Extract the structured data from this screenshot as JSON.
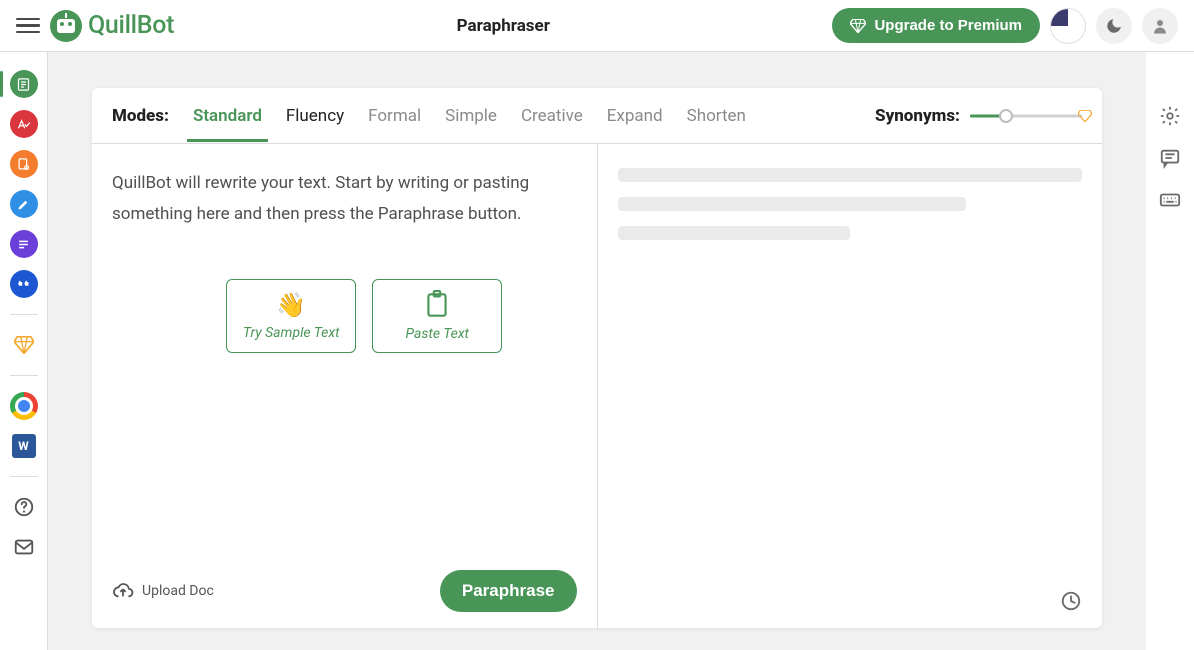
{
  "header": {
    "brand": "QuillBot",
    "title": "Paraphraser",
    "upgrade_label": "Upgrade to Premium"
  },
  "sidebar": {
    "items": [
      {
        "name": "paraphraser",
        "color": "#499557",
        "glyph": "doc"
      },
      {
        "name": "grammar-checker",
        "color": "#d9363e",
        "glyph": "check"
      },
      {
        "name": "plagiarism-checker",
        "color": "#f47c2e",
        "glyph": "page"
      },
      {
        "name": "co-writer",
        "color": "#2f8fe5",
        "glyph": "pen"
      },
      {
        "name": "summarizer",
        "color": "#6b3fd9",
        "glyph": "lines"
      },
      {
        "name": "citation-generator",
        "color": "#1d56d1",
        "glyph": "quote"
      }
    ],
    "premium": {
      "name": "premium",
      "color": "#f4a62a"
    },
    "extensions": [
      {
        "name": "chrome-extension"
      },
      {
        "name": "word-extension",
        "label": "W"
      }
    ],
    "footer": [
      {
        "name": "help"
      },
      {
        "name": "contact"
      }
    ]
  },
  "right_tools": [
    {
      "name": "settings"
    },
    {
      "name": "feedback"
    },
    {
      "name": "hotkeys"
    }
  ],
  "modes": {
    "label": "Modes:",
    "tabs": [
      {
        "key": "standard",
        "label": "Standard",
        "active": true,
        "premium": false
      },
      {
        "key": "fluency",
        "label": "Fluency",
        "active": false,
        "premium": false
      },
      {
        "key": "formal",
        "label": "Formal",
        "active": false,
        "premium": true
      },
      {
        "key": "simple",
        "label": "Simple",
        "active": false,
        "premium": true
      },
      {
        "key": "creative",
        "label": "Creative",
        "active": false,
        "premium": true
      },
      {
        "key": "expand",
        "label": "Expand",
        "active": false,
        "premium": true
      },
      {
        "key": "shorten",
        "label": "Shorten",
        "active": false,
        "premium": true
      }
    ],
    "synonyms_label": "Synonyms:",
    "synonyms_pct": 32
  },
  "input": {
    "placeholder": "QuillBot will rewrite your text. Start by writing or pasting something here and then press the Paraphrase button.",
    "sample_label": "Try Sample Text",
    "paste_label": "Paste Text",
    "upload_label": "Upload Doc",
    "paraphrase_label": "Paraphrase"
  }
}
